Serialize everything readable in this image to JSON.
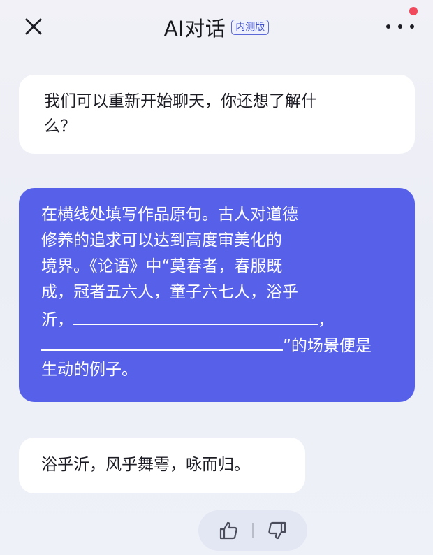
{
  "header": {
    "title": "AI对话",
    "badge": "内测版",
    "close_icon": "close-icon",
    "more_icon": "more-horizontal-icon",
    "notification_dot_color": "#f04a5c"
  },
  "messages": {
    "ai_greeting": {
      "line1": "我们可以重新开始聊天，你还想了解什",
      "line2": "么？"
    },
    "user_question": {
      "line1": "在横线处填写作品原句。古人对道德",
      "line2": "修养的追求可以达到高度审美化的",
      "line3": "境界。《论语》中“莫春者，春服既",
      "line4": "成，冠者五六人，童子六七人，浴乎",
      "line5_start": "沂，",
      "line5_end": "，",
      "line6_end": "”的场景便是",
      "line7": "生动的例子。"
    },
    "ai_answer": "浴乎沂，风乎舞雩，咏而归。"
  },
  "feedback": {
    "like_icon": "thumbs-up-icon",
    "dislike_icon": "thumbs-down-icon"
  },
  "colors": {
    "user_bubble": "#5660e9",
    "ai_bubble": "#ffffff",
    "badge": "#3d4ec6"
  }
}
